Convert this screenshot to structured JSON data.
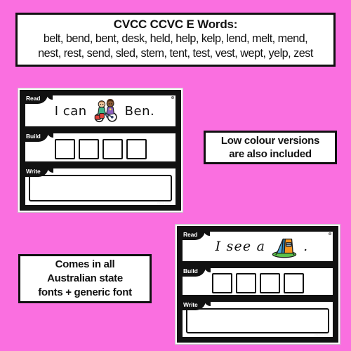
{
  "page": {
    "background_color": "#fa6fe0",
    "ink_color": "#111111",
    "paper_color": "#ffffff"
  },
  "header": {
    "title": "CVCC CCVC E Words:",
    "word_line_1": "belt, bend, bent, desk, held, help, kelp, lend, melt, mend,",
    "word_line_2": "nest, rest, send, sled, stem, tent, test, vest, wept, yelp, zest"
  },
  "cards": [
    {
      "id": "card-print",
      "read_label": "Read",
      "build_label": "Build",
      "write_label": "Write",
      "sentence_before": "I can",
      "sentence_after": "Ben.",
      "clipart": "kids-with-bicycle-icon",
      "build_box_count": 4,
      "watermark": "Lifelong Literacy",
      "font_style": "print"
    },
    {
      "id": "card-cursive",
      "read_label": "Read",
      "build_label": "Build",
      "write_label": "Write",
      "sentence_before": "I see a",
      "sentence_after": ".",
      "clipart": "camping-tent-icon",
      "build_box_count": 4,
      "watermark": "Lifelong Literacy",
      "font_style": "cursive"
    }
  ],
  "notes": {
    "low_colour_line_1": "Low colour versions",
    "low_colour_line_2": "are also included",
    "fonts_line_1": "Comes in all",
    "fonts_line_2": "Australian state",
    "fonts_line_3": "fonts + generic font"
  },
  "clipart_colors": {
    "tent_left": "#4aa8d8",
    "tent_right": "#f59520",
    "tent_grass": "#5cc14a",
    "boy_shirt": "#3fb58a",
    "girl_shirt": "#8b5fbf",
    "skin_light": "#f3c9a0",
    "skin_dark": "#8a5a35",
    "bike_body": "#3a4a6b"
  }
}
